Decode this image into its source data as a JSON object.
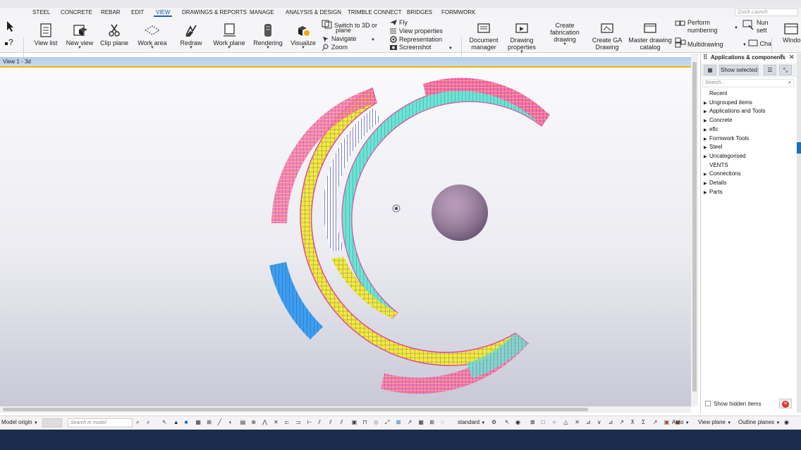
{
  "menu": {
    "tabs": [
      "STEEL",
      "CONCRETE",
      "REBAR",
      "EDIT",
      "VIEW",
      "DRAWINGS & REPORTS",
      "MANAGE",
      "ANALYSIS & DESIGN",
      "TRIMBLE CONNECT",
      "BRIDGES",
      "FORMWORK"
    ],
    "active": "VIEW",
    "quick_launch_placeholder": "Quick Launch"
  },
  "ribbon": {
    "view_list": "View list",
    "new_view": "New view",
    "clip_plane": "Clip plane",
    "work_area": "Work area",
    "redraw": "Redraw",
    "work_plane": "Work plane",
    "rendering": "Rendering",
    "visualize": "Visualize",
    "switch_3d": "Switch to 3D or",
    "switch_3d_2": "plane",
    "navigate": "Navigate",
    "zoom": "Zoom",
    "fly": "Fly",
    "view_properties": "View properties",
    "representation": "Representation",
    "screenshot": "Screenshot",
    "document_manager_1": "Document",
    "document_manager_2": "manager",
    "drawing_properties_1": "Drawing",
    "drawing_properties_2": "properties",
    "create_fab_1": "Create",
    "create_fab_2": "fabrication",
    "create_fab_3": "drawing",
    "create_ga_1": "Create GA",
    "create_ga_2": "Drawing",
    "master_catalog_1": "Master drawing",
    "master_catalog_2": "catalog",
    "perform_numbering_1": "Perform",
    "perform_numbering_2": "numbering",
    "multidrawing": "Multidrawing",
    "num_settings_1": "Nun",
    "num_settings_2": "sett",
    "change": "Cha",
    "window": "Windo"
  },
  "view": {
    "title": "View 1 - 3d"
  },
  "panel": {
    "title": "Applications & components",
    "show_selected": "Show selected",
    "search_placeholder": "Search...",
    "items": [
      {
        "label": "Recent",
        "arrow": false
      },
      {
        "label": "Ungrouped items",
        "arrow": true
      },
      {
        "label": "Applications and Tools",
        "arrow": true
      },
      {
        "label": "Concrete",
        "arrow": true
      },
      {
        "label": "eftc",
        "arrow": true
      },
      {
        "label": "Formwork Tools",
        "arrow": true
      },
      {
        "label": "Steel",
        "arrow": true
      },
      {
        "label": "Uncategorised",
        "arrow": true
      },
      {
        "label": "VENTS",
        "arrow": false
      },
      {
        "label": "Connections",
        "arrow": true
      },
      {
        "label": "Details",
        "arrow": true
      },
      {
        "label": "Parts",
        "arrow": true
      }
    ],
    "show_hidden": "Show hidden items"
  },
  "statusbar": {
    "origin": "Model origin",
    "search_placeholder": "Search in model",
    "standard": "standard",
    "auto": "Auto",
    "view_plane": "View plane",
    "outline_planes": "Outline planes"
  },
  "colors": {
    "accent": "#1d5fae",
    "view_border": "#f0b400",
    "bottom_bar": "#1a2d4c"
  }
}
